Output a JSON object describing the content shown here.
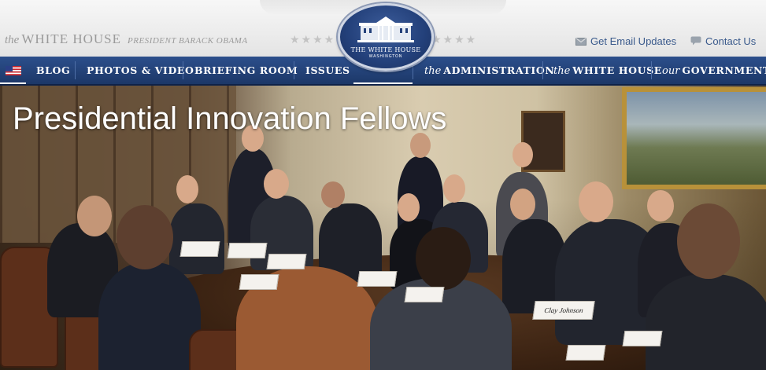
{
  "header": {
    "brand_the": "the",
    "brand_name": "WHITE HOUSE",
    "brand_sub": "PRESIDENT BARACK OBAMA",
    "stars_left": "★★★★",
    "stars_right": "★★★★",
    "seal_title": "THE WHITE HOUSE",
    "seal_sub": "WASHINGTON",
    "email_updates": "Get Email Updates",
    "contact_us": "Contact Us",
    "icons": {
      "email": "envelope-icon",
      "contact": "speech-bubble-icon",
      "flag": "us-flag-icon"
    }
  },
  "nav": {
    "blog": "BLOG",
    "photos_video": "PHOTOS & VIDEO",
    "briefing_room": "BRIEFING ROOM",
    "issues": "ISSUES",
    "administration_prefix": "the",
    "administration": "ADMINISTRATION",
    "white_house_prefix": "the",
    "white_house": "WHITE HOUSE",
    "government_prefix": "our",
    "government": "GOVERNMENT"
  },
  "hero": {
    "title": "Presidential Innovation Fellows",
    "name_card": "Clay Johnson"
  },
  "colors": {
    "nav_bg": "#1c3767",
    "link": "#3a5a8c",
    "header_text": "#9a9a9a",
    "seal_bg": "#23407a"
  }
}
